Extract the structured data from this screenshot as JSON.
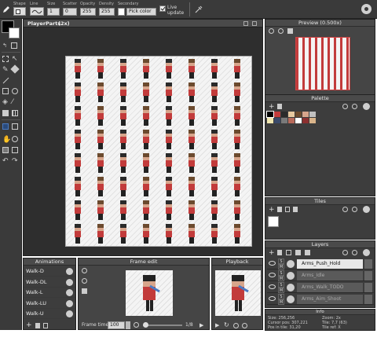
{
  "toolbar": {
    "shape_label": "Shape",
    "line_label": "Line",
    "size_label": "Size",
    "size_value": "1",
    "scatter_label": "Scatter",
    "scatter_value": "0",
    "opacity_label": "Opacity",
    "opacity_value": "255",
    "density_label": "Density",
    "density_value": "255",
    "secondary_label": "Secondary",
    "secondary_value": "Pick color",
    "live_update_label": "Live update"
  },
  "canvas": {
    "title": "PlayerParts",
    "zoom": "(2x)"
  },
  "preview": {
    "title": "Preview (0.500x)"
  },
  "palette": {
    "title": "Palette",
    "colors": [
      "#000000",
      "#c23b3b",
      "#2b2b2b",
      "#e8c9a0",
      "#6b4a2e",
      "#d7a58b",
      "#c0c0c0",
      "#f0e6b0",
      "#3a4a6a",
      "#7a7a7a",
      "#b86a5a",
      "#ffffff",
      "#8c3030",
      "#d9b48a"
    ]
  },
  "tiles": {
    "title": "Tiles"
  },
  "layers": {
    "title": "Layers",
    "items": [
      {
        "name": "Arms_Push_Hold",
        "active": true
      },
      {
        "name": "Arms_Idle",
        "active": false
      },
      {
        "name": "Arms_Walk_TODO",
        "active": false
      },
      {
        "name": "Arms_Aim_Shoot",
        "active": false
      }
    ]
  },
  "info": {
    "title": "Info",
    "size": "Size: 256,256",
    "zoom": "Zoom: 2x",
    "cursor": "Cursor pos: 307,221",
    "tile": "Tile: 7,7 (63)",
    "pos_in_tile": "Pos in tile: 31,20",
    "tile_ref": "Tile ref: X"
  },
  "animations": {
    "title": "Animations",
    "items": [
      "Walk-D",
      "Walk-DL",
      "Walk-L",
      "Walk-LU",
      "Walk-U"
    ]
  },
  "frame_edit": {
    "title": "Frame edit",
    "frame_time_label": "Frame time",
    "frame_time_value": "100",
    "frame_counter": "1/8"
  },
  "playback": {
    "title": "Playback"
  },
  "colors": {
    "app_bg": "#3c3c3c",
    "panel_bg": "#454545",
    "canvas_bg": "#2e2e2e",
    "shirt": "#c23b3b",
    "hair": "#6b4a2e",
    "accent": "#4a7ac2"
  }
}
